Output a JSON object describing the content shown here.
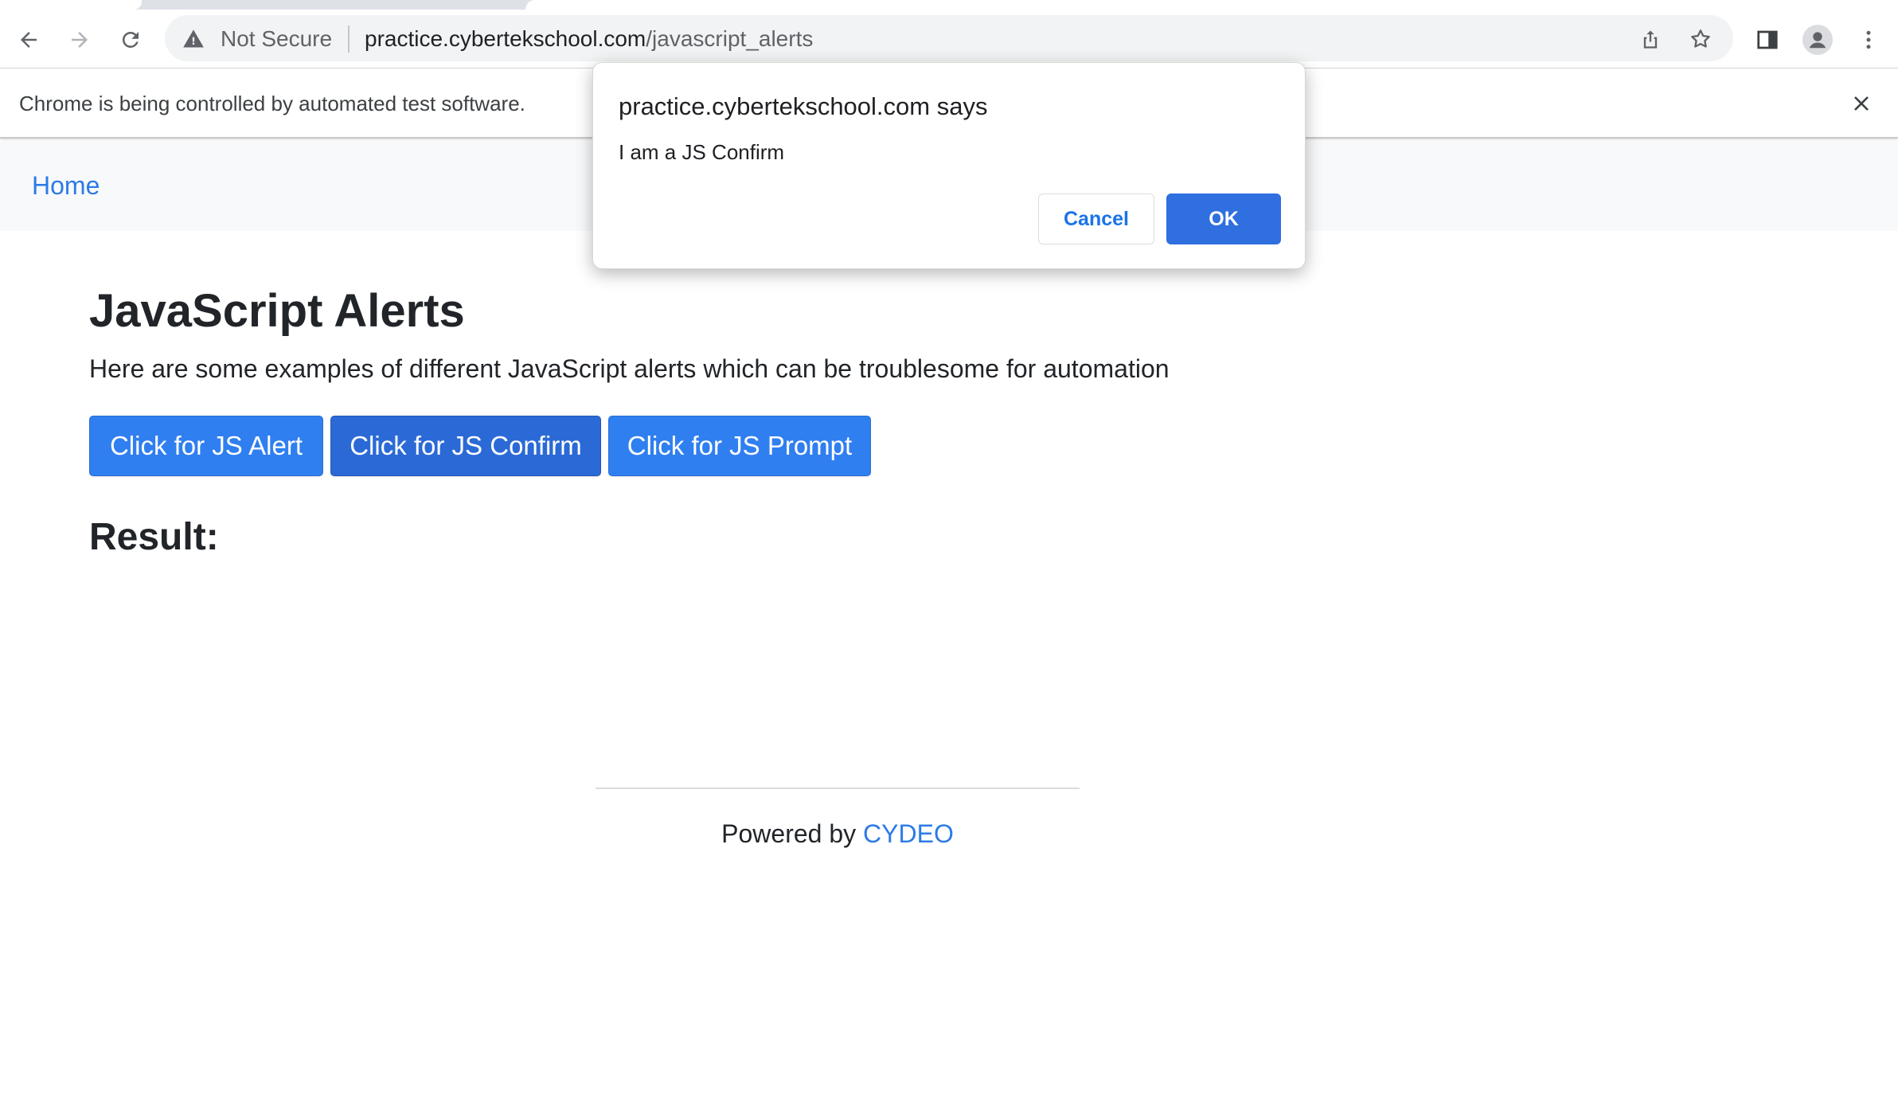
{
  "browser": {
    "security_label": "Not Secure",
    "url_host": "practice.cybertekschool.com",
    "url_path": "/javascript_alerts",
    "infobar_message": "Chrome is being controlled by automated test software."
  },
  "page": {
    "nav_home": "Home",
    "title": "JavaScript Alerts",
    "description": "Here are some examples of different JavaScript alerts which can be troublesome for automation",
    "buttons": [
      {
        "label": "Click for JS Alert"
      },
      {
        "label": "Click for JS Confirm"
      },
      {
        "label": "Click for JS Prompt"
      }
    ],
    "result_title": "Result:",
    "footer_prefix": "Powered by",
    "footer_brand": "CYDEO"
  },
  "dialog": {
    "title": "practice.cybertekschool.com says",
    "message": "I am a JS Confirm",
    "cancel_label": "Cancel",
    "ok_label": "OK"
  },
  "colors": {
    "link": "#2c7be5",
    "button": "#2f7ff0",
    "dialog_ok": "#2f6fdf",
    "navbar_bg": "#f8f9fa"
  },
  "icons": [
    "back-arrow-icon",
    "forward-arrow-icon",
    "reload-icon",
    "warning-triangle-icon",
    "share-icon",
    "star-icon",
    "side-panel-icon",
    "profile-avatar-icon",
    "kebab-menu-icon",
    "close-icon"
  ]
}
